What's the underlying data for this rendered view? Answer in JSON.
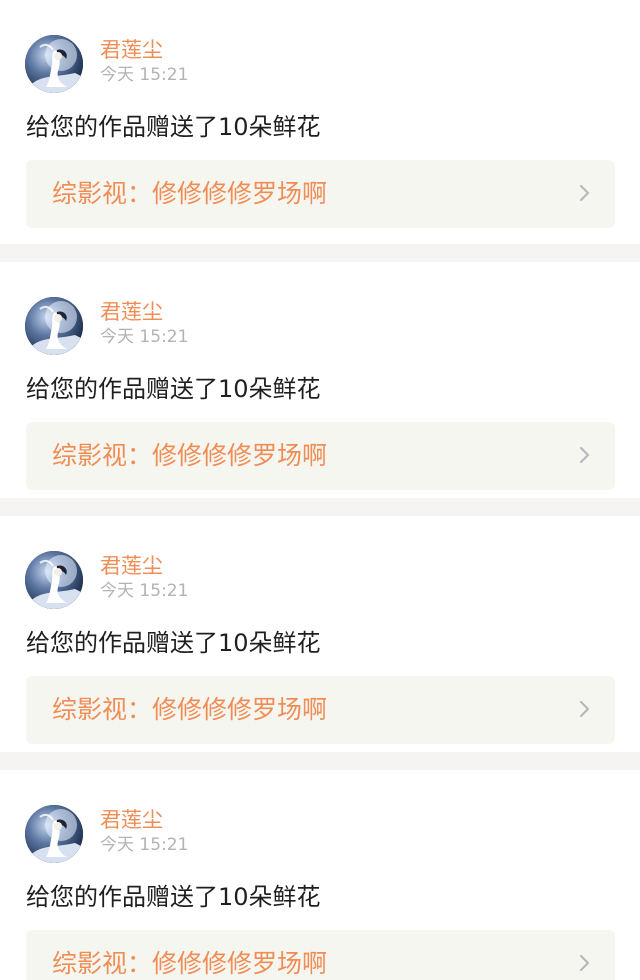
{
  "items": [
    {
      "user_name": "君莲尘",
      "timestamp": "今天 15:21",
      "message": "给您的作品赠送了10朵鲜花",
      "work_label": "综影视：",
      "work_title": "修修修修罗场啊",
      "avatar_icon": "avatar-icon",
      "chevron_icon": "chevron-right-icon"
    },
    {
      "user_name": "君莲尘",
      "timestamp": "今天 15:21",
      "message": "给您的作品赠送了10朵鲜花",
      "work_label": "综影视：",
      "work_title": "修修修修罗场啊",
      "avatar_icon": "avatar-icon",
      "chevron_icon": "chevron-right-icon"
    },
    {
      "user_name": "君莲尘",
      "timestamp": "今天 15:21",
      "message": "给您的作品赠送了10朵鲜花",
      "work_label": "综影视：",
      "work_title": "修修修修罗场啊",
      "avatar_icon": "avatar-icon",
      "chevron_icon": "chevron-right-icon"
    },
    {
      "user_name": "君莲尘",
      "timestamp": "今天 15:21",
      "message": "给您的作品赠送了10朵鲜花",
      "work_label": "综影视：",
      "work_title": "修修修修罗场啊",
      "avatar_icon": "avatar-icon",
      "chevron_icon": "chevron-right-icon"
    }
  ],
  "colors": {
    "accent": "#f08d55",
    "timestamp": "#b3b3b3",
    "message": "#1f1f1f",
    "link_background": "#f6f6f1",
    "separator": "#f5f4f2"
  }
}
